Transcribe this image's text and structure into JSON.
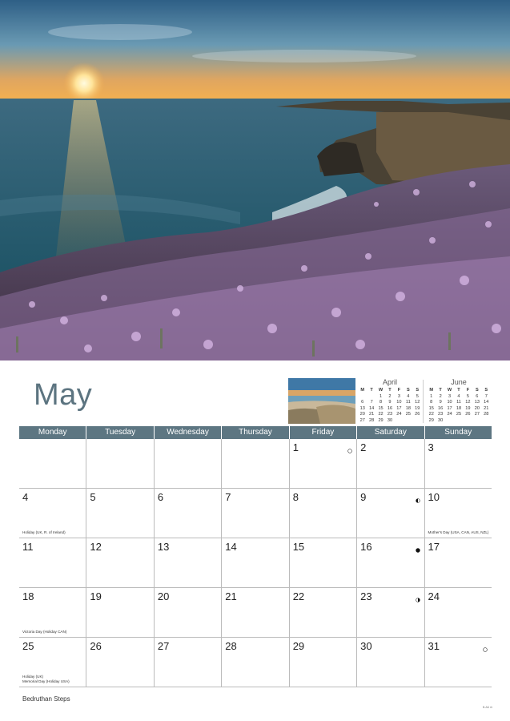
{
  "month": "May",
  "photo_caption": "Bedruthan Steps",
  "code": "B-A6 rlr",
  "weekdays": [
    "Monday",
    "Tuesday",
    "Wednesday",
    "Thursday",
    "Friday",
    "Saturday",
    "Sunday"
  ],
  "prev_month": {
    "name": "April",
    "header": [
      "M",
      "T",
      "W",
      "T",
      "F",
      "S",
      "S"
    ],
    "rows": [
      [
        "",
        "",
        "1",
        "2",
        "3",
        "4",
        "5"
      ],
      [
        "6",
        "7",
        "8",
        "9",
        "10",
        "11",
        "12"
      ],
      [
        "13",
        "14",
        "15",
        "16",
        "17",
        "18",
        "19"
      ],
      [
        "20",
        "21",
        "22",
        "23",
        "24",
        "25",
        "26"
      ],
      [
        "27",
        "28",
        "29",
        "30",
        "",
        "",
        ""
      ]
    ]
  },
  "next_month": {
    "name": "June",
    "header": [
      "M",
      "T",
      "W",
      "T",
      "F",
      "S",
      "S"
    ],
    "rows": [
      [
        "1",
        "2",
        "3",
        "4",
        "5",
        "6",
        "7"
      ],
      [
        "8",
        "9",
        "10",
        "11",
        "12",
        "13",
        "14"
      ],
      [
        "15",
        "16",
        "17",
        "18",
        "19",
        "20",
        "21"
      ],
      [
        "22",
        "23",
        "24",
        "25",
        "26",
        "27",
        "28"
      ],
      [
        "29",
        "30",
        "",
        "",
        "",
        "",
        ""
      ]
    ]
  },
  "weeks": [
    [
      {
        "n": ""
      },
      {
        "n": ""
      },
      {
        "n": ""
      },
      {
        "n": ""
      },
      {
        "n": "1",
        "moon": "full"
      },
      {
        "n": "2"
      },
      {
        "n": "3"
      }
    ],
    [
      {
        "n": "4",
        "note": "Holiday (UK, R. of Ireland)"
      },
      {
        "n": "5"
      },
      {
        "n": "6"
      },
      {
        "n": "7"
      },
      {
        "n": "8"
      },
      {
        "n": "9",
        "moon": "last-quarter"
      },
      {
        "n": "10",
        "note": "Mother's Day (USA, CAN, AUS, NZL)"
      }
    ],
    [
      {
        "n": "11"
      },
      {
        "n": "12"
      },
      {
        "n": "13"
      },
      {
        "n": "14"
      },
      {
        "n": "15"
      },
      {
        "n": "16",
        "moon": "new"
      },
      {
        "n": "17"
      }
    ],
    [
      {
        "n": "18",
        "note": "Victoria Day (Holiday CAN)"
      },
      {
        "n": "19"
      },
      {
        "n": "20"
      },
      {
        "n": "21"
      },
      {
        "n": "22"
      },
      {
        "n": "23",
        "moon": "first-quarter"
      },
      {
        "n": "24"
      }
    ],
    [
      {
        "n": "25",
        "note": "Holiday (UK)\nMemorial Day (Holiday USA)"
      },
      {
        "n": "26"
      },
      {
        "n": "27"
      },
      {
        "n": "28"
      },
      {
        "n": "29"
      },
      {
        "n": "30"
      },
      {
        "n": "31",
        "moon": "full"
      }
    ]
  ]
}
